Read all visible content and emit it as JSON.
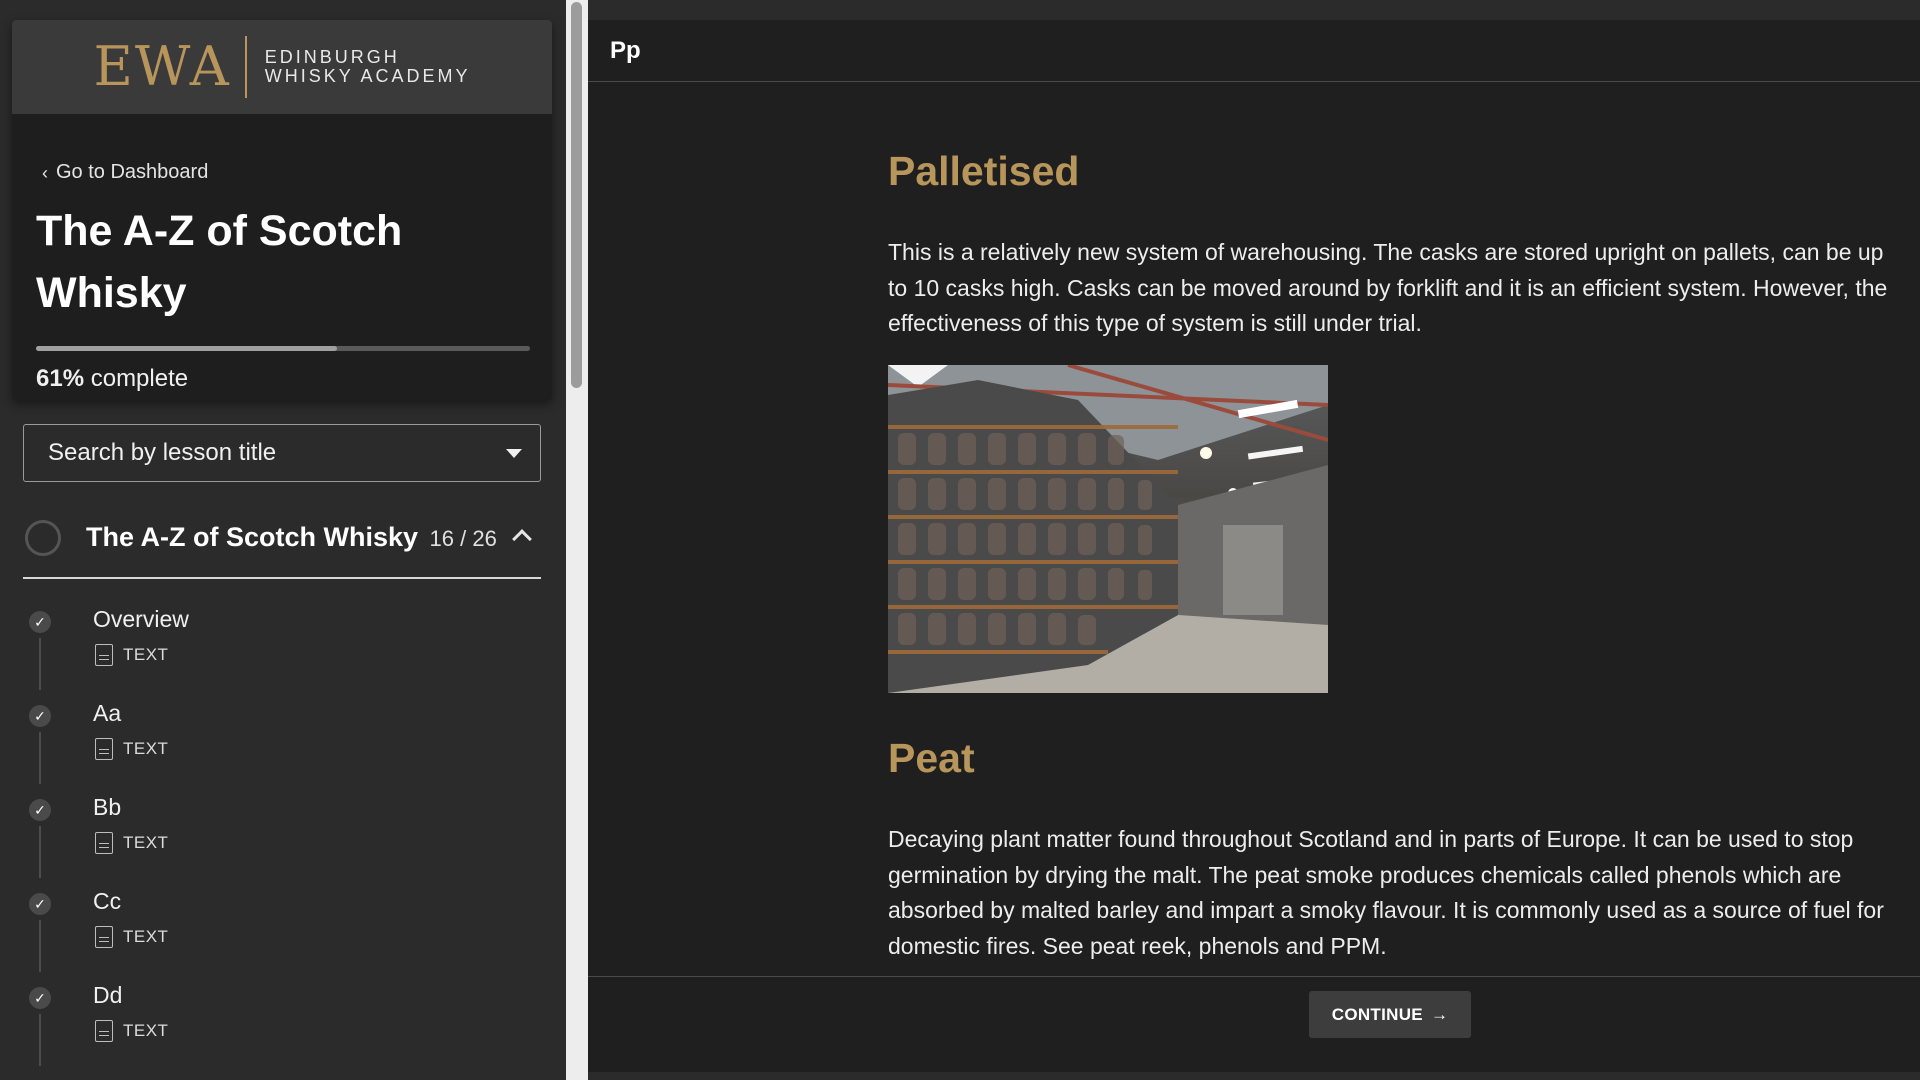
{
  "brand": {
    "mark": "EWA",
    "name_line1": "EDINBURGH",
    "name_line2": "WHISKY ACADEMY",
    "gold": "#b8955a"
  },
  "sidebar": {
    "back_link": "Go to Dashboard",
    "course_title": "The A-Z of Scotch Whisky",
    "progress_percent": "61%",
    "progress_suffix": "complete",
    "progress_fraction": 0.61,
    "search_placeholder": "Search by lesson title",
    "section": {
      "title": "The A-Z of Scotch Whisky",
      "count": "16 / 26"
    },
    "lessons": [
      {
        "name": "Overview",
        "type": "TEXT",
        "completed": true
      },
      {
        "name": "Aa",
        "type": "TEXT",
        "completed": true
      },
      {
        "name": "Bb",
        "type": "TEXT",
        "completed": true
      },
      {
        "name": "Cc",
        "type": "TEXT",
        "completed": true
      },
      {
        "name": "Dd",
        "type": "TEXT",
        "completed": true
      }
    ]
  },
  "main": {
    "letter": "Pp",
    "terms": [
      {
        "title": "Palletised",
        "body": "This is a relatively new system of warehousing. The casks are stored upright on pallets, can be up to 10 casks high. Casks can be moved around by forklift and it is an efficient system. However, the effectiveness of this type of system is still under trial."
      },
      {
        "title": "Peat",
        "body": "Decaying plant matter found throughout Scotland and in parts of Europe. It can be used to stop germination by drying the malt. The peat smoke produces chemicals called phenols which are absorbed by malted barley and impart a smoky flavour.  It is commonly used as a source of fuel for domestic fires. See peat reek, phenols and PPM."
      }
    ],
    "continue_label": "CONTINUE",
    "continue_icon": "arrow-right-icon"
  }
}
